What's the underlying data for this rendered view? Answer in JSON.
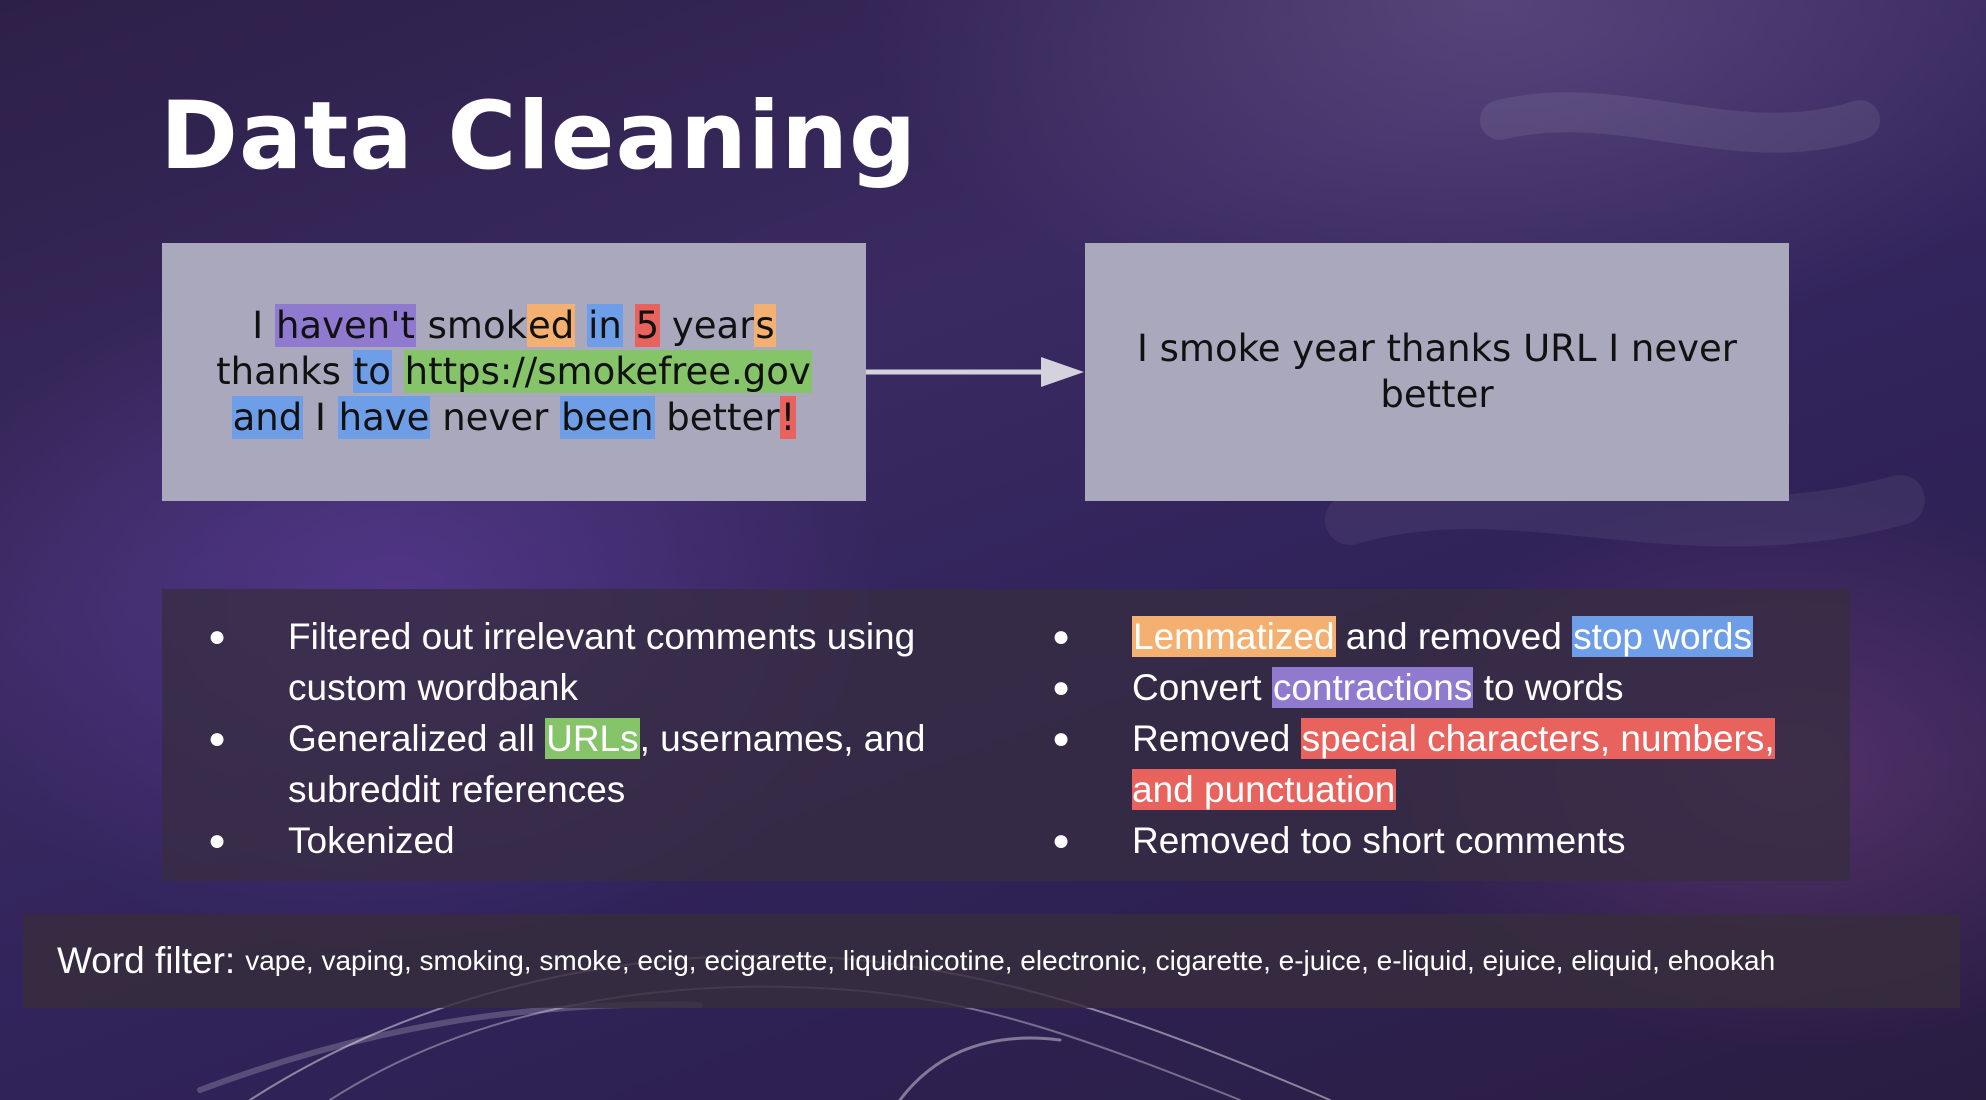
{
  "slide": {
    "title": "Data Cleaning",
    "original": {
      "w1": "I ",
      "w2": "haven't",
      "w3": " smok",
      "w4": "ed",
      "w5": " ",
      "w6": "in",
      "w7": " ",
      "w8": "5",
      "w9": " year",
      "w10": "s",
      "w11": "thanks ",
      "w12": "to",
      "w13": " ",
      "w14": "https://smokefree.gov",
      "w15": "and",
      "w16": " I ",
      "w17": "have",
      "w18": " never ",
      "w19": "been",
      "w20": " better",
      "w21": "!"
    },
    "cleaned_text": "I smoke year thanks URL I never better",
    "bullets_left": [
      {
        "text": "Filtered out irrelevant comments using custom wordbank"
      },
      {
        "pre": "Generalized all ",
        "hl": "URLs",
        "post": ", usernames, and subreddit references"
      },
      {
        "text": "Tokenized"
      }
    ],
    "bullets_right": [
      {
        "hl1": "Lemmatized",
        "mid": " and removed ",
        "hl2": "stop words"
      },
      {
        "pre": "Convert ",
        "hl": "contractions",
        "post": " to words"
      },
      {
        "pre": "Removed ",
        "hl": "special characters, numbers, and punctuation"
      },
      {
        "text": "Removed too short comments"
      }
    ],
    "bullet_symbol": "●",
    "word_filter": {
      "label": "Word filter:",
      "words": "vape, vaping, smoking, smoke, ecig, ecigarette, liquidnicotine, electronic, cigarette, e-juice, e-liquid, ejuice, eliquid, ehookah"
    },
    "colors": {
      "purple": "#8f7ad0",
      "orange": "#f4b070",
      "blue": "#6f9ee8",
      "red": "#e8625e",
      "green": "#86c46a",
      "box": "#aaa8bc"
    }
  }
}
